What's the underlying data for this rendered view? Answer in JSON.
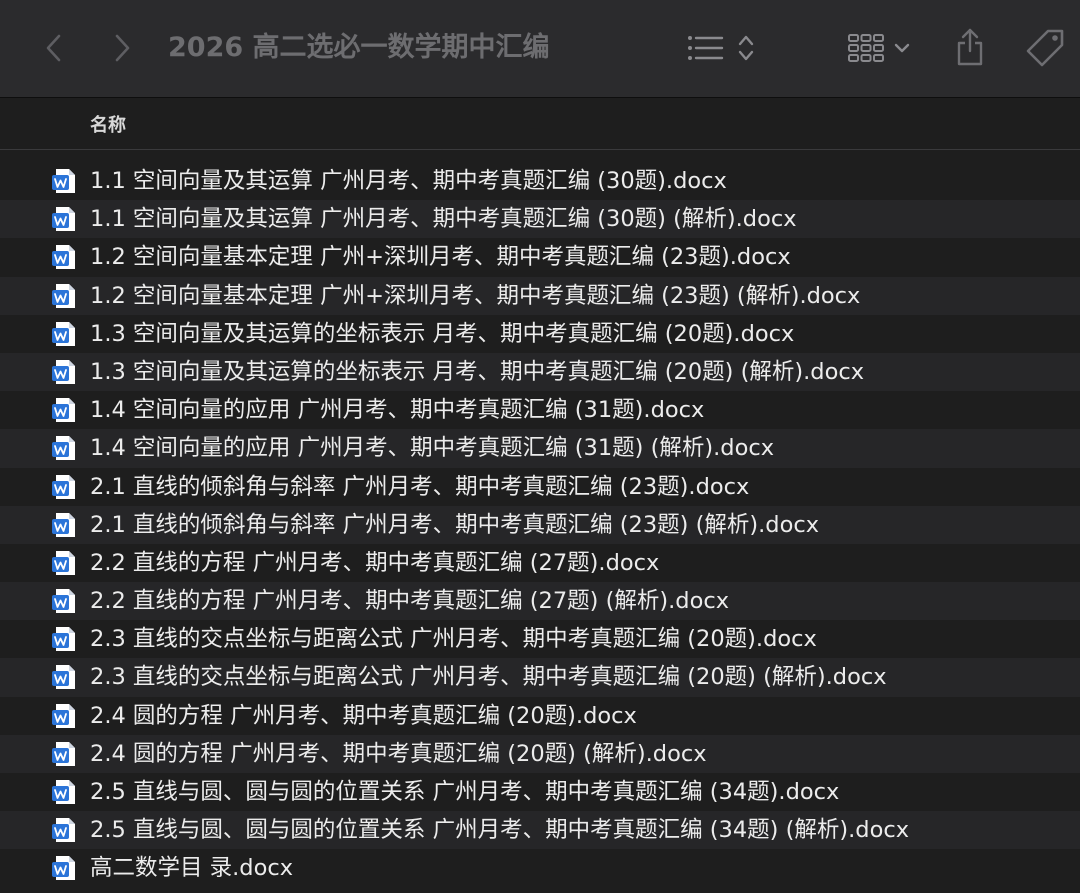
{
  "toolbar": {
    "title": "2026 高二选必一数学期中汇编"
  },
  "columns": {
    "name": "名称"
  },
  "files": [
    "1.1 空间向量及其运算 广州月考、期中考真题汇编 (30题).docx",
    "1.1 空间向量及其运算 广州月考、期中考真题汇编 (30题) (解析).docx",
    "1.2 空间向量基本定理 广州+深圳月考、期中考真题汇编 (23题).docx",
    "1.2 空间向量基本定理 广州+深圳月考、期中考真题汇编 (23题) (解析).docx",
    "1.3 空间向量及其运算的坐标表示 月考、期中考真题汇编 (20题).docx",
    "1.3 空间向量及其运算的坐标表示 月考、期中考真题汇编 (20题) (解析).docx",
    "1.4 空间向量的应用 广州月考、期中考真题汇编 (31题).docx",
    "1.4 空间向量的应用 广州月考、期中考真题汇编 (31题) (解析).docx",
    "2.1 直线的倾斜角与斜率 广州月考、期中考真题汇编 (23题).docx",
    "2.1 直线的倾斜角与斜率 广州月考、期中考真题汇编 (23题) (解析).docx",
    "2.2 直线的方程 广州月考、期中考真题汇编 (27题).docx",
    "2.2 直线的方程 广州月考、期中考真题汇编 (27题) (解析).docx",
    "2.3 直线的交点坐标与距离公式 广州月考、期中考真题汇编 (20题).docx",
    "2.3 直线的交点坐标与距离公式 广州月考、期中考真题汇编 (20题) (解析).docx",
    "2.4 圆的方程 广州月考、期中考真题汇编 (20题).docx",
    "2.4 圆的方程 广州月考、期中考真题汇编 (20题) (解析).docx",
    "2.5 直线与圆、圆与圆的位置关系 广州月考、期中考真题汇编 (34题).docx",
    "2.5 直线与圆、圆与圆的位置关系 广州月考、期中考真题汇编 (34题) (解析).docx",
    "高二数学目 录.docx"
  ],
  "icons": {
    "file_icon": "word-doc-icon",
    "word_blue": "#2b74d8"
  }
}
